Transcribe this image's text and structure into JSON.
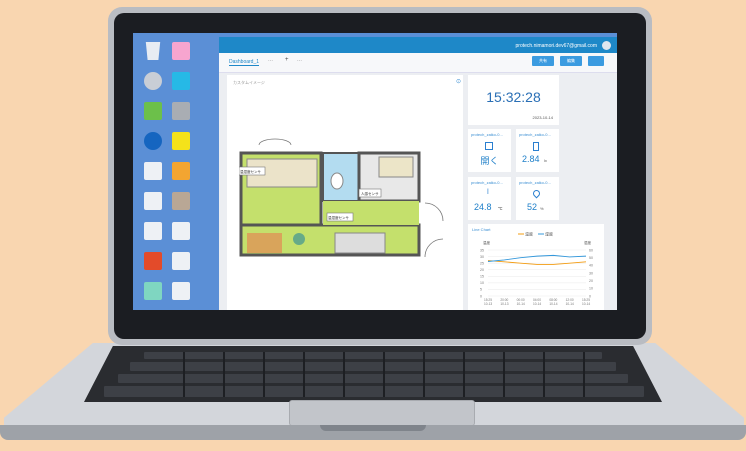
{
  "app": {
    "account_email": "protech.nimamori.dev67@gmail.com",
    "tab_label": "Dashboard_1",
    "tab_more": "⋯",
    "tab_add": "+",
    "tab_menu": "⋯",
    "btn_share": "共有",
    "btn_edit": "編集"
  },
  "map": {
    "title": "カスタムイメージ",
    "labels": [
      "温湿度センサ",
      "人感センサ",
      "温湿度センサ"
    ]
  },
  "clock": {
    "time": "15:32:28",
    "date": "2023-10-14"
  },
  "sensors": [
    {
      "name": "protech_zaiko-0...",
      "value": "開く",
      "unit": ""
    },
    {
      "name": "protech_zaiko-0...",
      "value": "2.84",
      "unit": "lx"
    },
    {
      "name": "protech_zaiko-0...",
      "value": "24.8",
      "unit": "℃"
    },
    {
      "name": "protech_zaiko-0...",
      "value": "52",
      "unit": "%"
    }
  ],
  "chart_data": {
    "type": "line",
    "title": "Line Chart",
    "x": [
      "15:25\n10-13",
      "20:00\n10-13",
      "00:00\n10-14",
      "04:00\n10-14",
      "08:00\n10-14",
      "12:00\n10-14",
      "15:25\n10-14"
    ],
    "series": [
      {
        "name": "温度",
        "color": "#f39c12",
        "values": [
          27,
          26,
          25,
          24,
          24,
          25,
          26
        ]
      },
      {
        "name": "湿度",
        "color": "#3498db",
        "values": [
          45,
          47,
          50,
          52,
          53,
          51,
          52
        ]
      }
    ],
    "ylabel_left": "温度",
    "ylabel_right": "湿度",
    "yleft_ticks": [
      "35",
      "30",
      "25",
      "20",
      "15",
      "10",
      "5",
      "0"
    ],
    "yright_ticks": [
      "60",
      "50",
      "40",
      "30",
      "20",
      "10",
      "0"
    ],
    "ylim_left": [
      0,
      35
    ],
    "ylim_right": [
      0,
      60
    ]
  }
}
